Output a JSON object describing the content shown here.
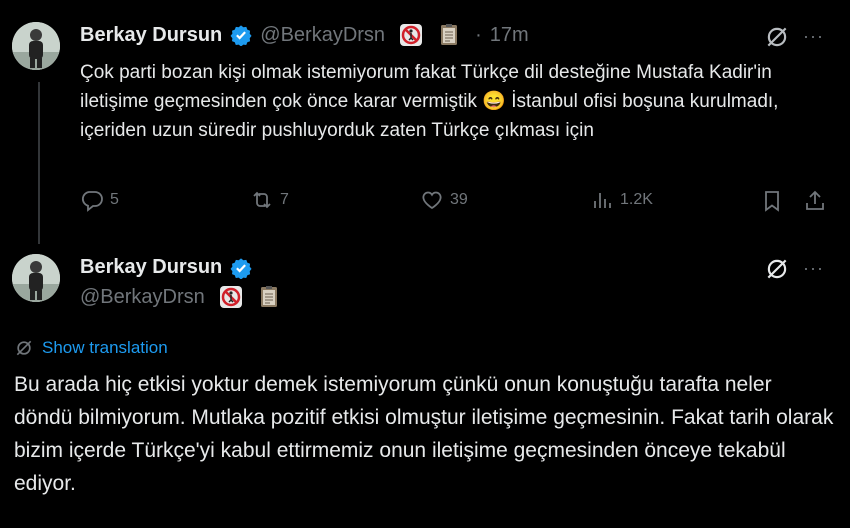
{
  "tweet1": {
    "name": "Berkay Dursun",
    "handle": "@BerkayDrsn",
    "dot": "·",
    "time": "17m",
    "text": "Çok parti bozan kişi olmak istemiyorum fakat Türkçe dil desteğine Mustafa Kadir'in iletişime geçmesinden çok önce karar vermiştik 😄 İstanbul ofisi boşuna kurulmadı, içeriden uzun süredir pushluyorduk zaten Türkçe çıkması için",
    "replies": "5",
    "reposts": "7",
    "likes": "39",
    "views": "1.2K",
    "more": "···"
  },
  "tweet2": {
    "name": "Berkay Dursun",
    "handle": "@BerkayDrsn",
    "show_translation": "Show translation",
    "text": "Bu arada hiç etkisi yoktur demek istemiyorum çünkü onun konuştuğu tarafta neler döndü bilmiyorum. Mutlaka pozitif etkisi olmuştur iletişime geçmesinin. Fakat tarih olarak bizim içerde Türkçe'yi kabul ettirmemiz onun iletişime geçmesinden önceye tekabül ediyor.",
    "more": "···"
  },
  "colors": {
    "accent": "#1d9bf0",
    "muted": "#71767b",
    "text": "#e7e9ea",
    "background": "#000000"
  }
}
